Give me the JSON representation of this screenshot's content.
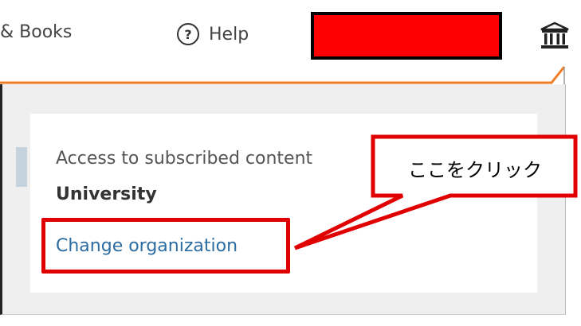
{
  "header": {
    "nav_books": "& Books",
    "help_label": "Help",
    "help_icon": "help-circle-icon",
    "institution_icon": "institution-icon",
    "accent_color": "#f07c24",
    "redaction_color": "#ff0000"
  },
  "access_panel": {
    "access_text": "Access to subscribed content",
    "organization_name": "University",
    "change_organization_label": "Change organization",
    "link_color": "#2b6ca3"
  },
  "annotation": {
    "callout_text": "ここをクリック",
    "callout_color": "#e00000"
  }
}
